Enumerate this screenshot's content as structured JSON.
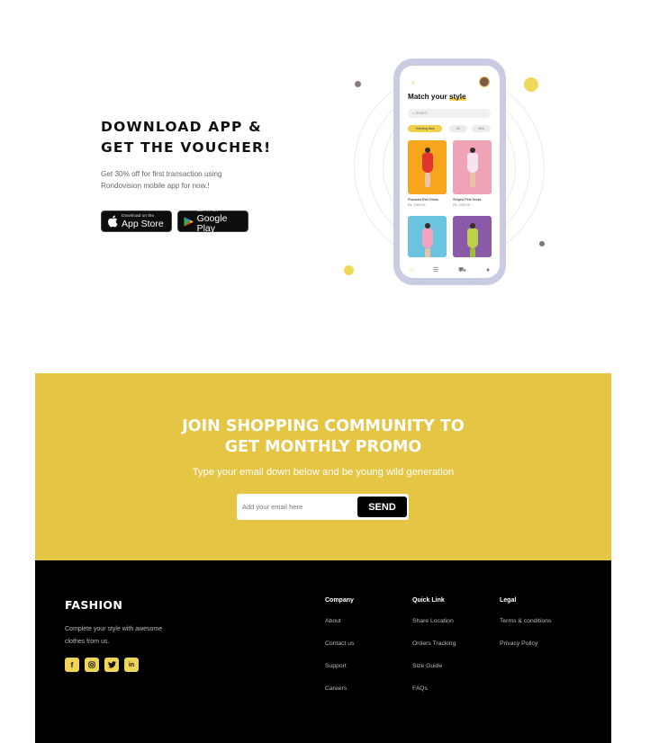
{
  "download": {
    "title_line1": "DOWNLOAD APP &",
    "title_line2": "GET THE VOUCHER!",
    "desc_line1": "Get 30% off for first transaction using",
    "desc_line2": "Rondovision mobile app for now.!",
    "app_store": {
      "small": "Download on the",
      "big": "App Store"
    },
    "google_play": {
      "small": "GET IT ON",
      "big": "Google Play"
    }
  },
  "phone": {
    "title_prefix": "Match your ",
    "title_highlight": "style",
    "search_placeholder": "Search",
    "chips": [
      "Trending Now",
      "All",
      "New"
    ],
    "products": [
      {
        "name": "Polcadot Red Dress",
        "price": "Rs. 1400.00"
      },
      {
        "name": "Striped Pink Dress",
        "price": "Rs. 1200.00"
      }
    ]
  },
  "promo": {
    "title_line1": "JOIN SHOPPING COMMUNITY TO",
    "title_line2": "GET MONTHLY PROMO",
    "subtitle": "Type your email down below and be young wild generation",
    "email_placeholder": "Add your email here",
    "send_label": "SEND"
  },
  "footer": {
    "brand": "FASHION",
    "desc_line1": "Complete your style with awesome",
    "desc_line2": "clothes from us.",
    "socials": [
      "facebook-icon",
      "instagram-icon",
      "twitter-icon",
      "linkedin-icon"
    ],
    "columns": [
      {
        "title": "Company",
        "links": [
          "About",
          "Contact us",
          "Support",
          "Careers"
        ]
      },
      {
        "title": "Quick Link",
        "links": [
          "Share Location",
          "Orders Tracking",
          "Size Guide",
          "FAQs"
        ]
      },
      {
        "title": "Legal",
        "links": [
          "Terms & conditions",
          "Privacy Policy"
        ]
      }
    ]
  },
  "colors": {
    "accent_yellow": "#e5c544",
    "footer_bg": "#000000",
    "social_icon_bg": "#efd45a"
  }
}
